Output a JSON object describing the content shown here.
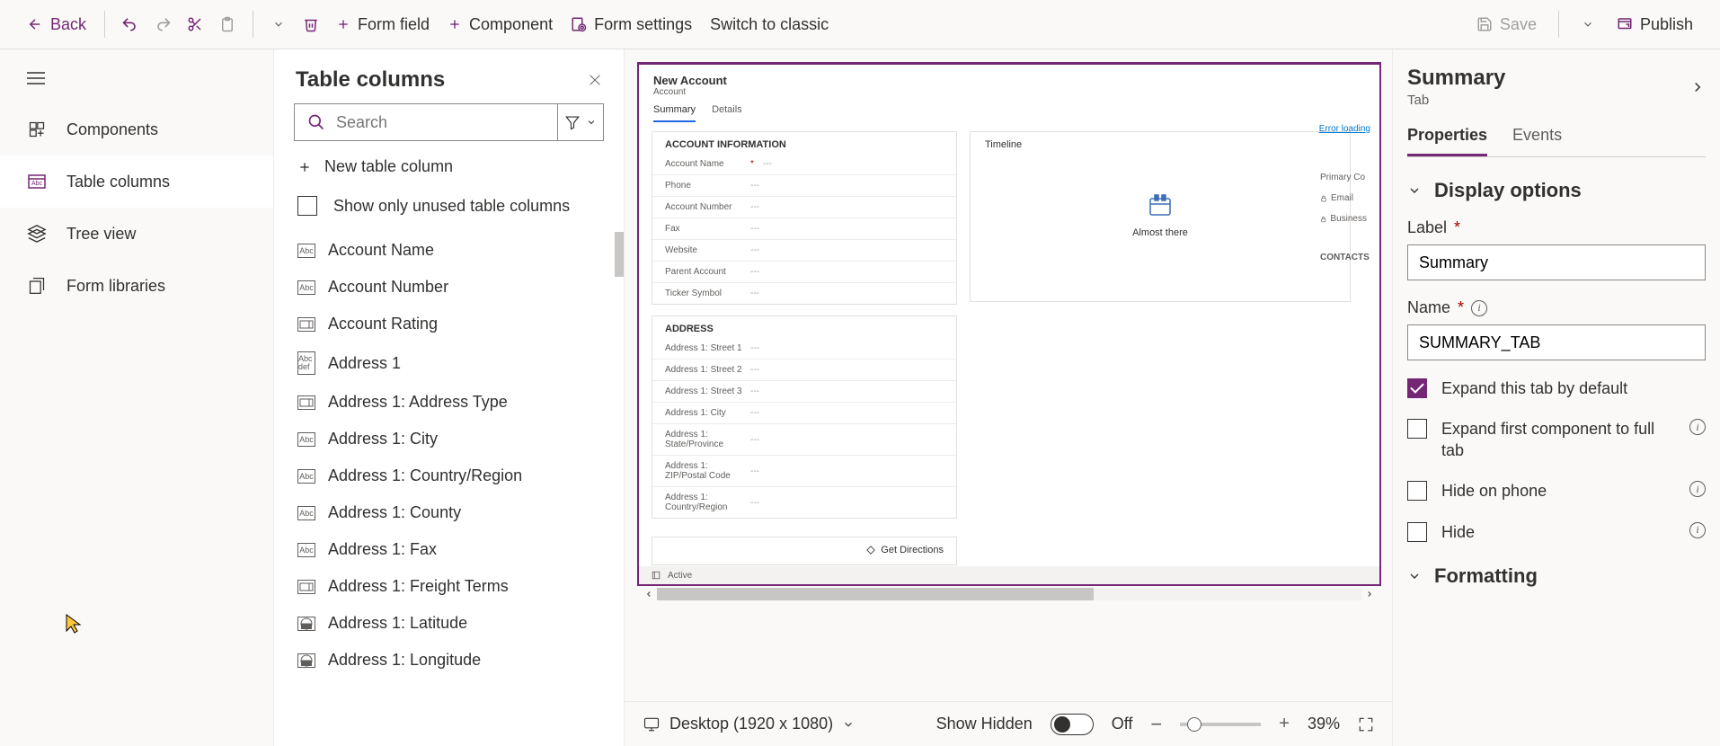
{
  "toolbar": {
    "back": "Back",
    "form_field": "Form field",
    "component": "Component",
    "form_settings": "Form settings",
    "switch_classic": "Switch to classic",
    "save": "Save",
    "publish": "Publish"
  },
  "left_rail": {
    "items": [
      {
        "label": "Components"
      },
      {
        "label": "Table columns"
      },
      {
        "label": "Tree view"
      },
      {
        "label": "Form libraries"
      }
    ]
  },
  "columns_panel": {
    "title": "Table columns",
    "search_placeholder": "Search",
    "new_col": "New table column",
    "show_unused": "Show only unused table columns",
    "columns": [
      {
        "icon": "Abc",
        "label": "Account Name"
      },
      {
        "icon": "Abc",
        "label": "Account Number"
      },
      {
        "icon": "opt",
        "label": "Account Rating"
      },
      {
        "icon": "Abc\ndef",
        "label": "Address 1"
      },
      {
        "icon": "opt",
        "label": "Address 1: Address Type"
      },
      {
        "icon": "Abc",
        "label": "Address 1: City"
      },
      {
        "icon": "Abc",
        "label": "Address 1: Country/Region"
      },
      {
        "icon": "Abc",
        "label": "Address 1: County"
      },
      {
        "icon": "Abc",
        "label": "Address 1: Fax"
      },
      {
        "icon": "opt",
        "label": "Address 1: Freight Terms"
      },
      {
        "icon": "geo",
        "label": "Address 1: Latitude"
      },
      {
        "icon": "geo",
        "label": "Address 1: Longitude"
      }
    ]
  },
  "form_preview": {
    "title": "New Account",
    "subtitle": "Account",
    "tabs": [
      "Summary",
      "Details"
    ],
    "error_loading": "Error loading",
    "section1_title": "ACCOUNT INFORMATION",
    "section1_fields": [
      {
        "label": "Account Name",
        "required": true,
        "value": "---"
      },
      {
        "label": "Phone",
        "value": "---"
      },
      {
        "label": "Account Number",
        "value": "---"
      },
      {
        "label": "Fax",
        "value": "---"
      },
      {
        "label": "Website",
        "value": "---"
      },
      {
        "label": "Parent Account",
        "value": "---"
      },
      {
        "label": "Ticker Symbol",
        "value": "---"
      }
    ],
    "section2_title": "ADDRESS",
    "section2_fields": [
      {
        "label": "Address 1: Street 1",
        "value": "---"
      },
      {
        "label": "Address 1: Street 2",
        "value": "---"
      },
      {
        "label": "Address 1: Street 3",
        "value": "---"
      },
      {
        "label": "Address 1: City",
        "value": "---"
      },
      {
        "label": "Address 1: State/Province",
        "value": "---"
      },
      {
        "label": "Address 1: ZIP/Postal Code",
        "value": "---"
      },
      {
        "label": "Address 1: Country/Region",
        "value": "---"
      }
    ],
    "get_directions": "Get Directions",
    "timeline_title": "Timeline",
    "timeline_status": "Almost there",
    "right_col": {
      "primary": "Primary Co",
      "email": "Email",
      "business": "Business",
      "contacts": "CONTACTS"
    },
    "status_bar": "Active"
  },
  "canvas_footer": {
    "device": "Desktop (1920 x 1080)",
    "show_hidden": "Show Hidden",
    "toggle_state": "Off",
    "zoom": "39%"
  },
  "props": {
    "title": "Summary",
    "subtitle": "Tab",
    "tabs": [
      "Properties",
      "Events"
    ],
    "section_display": "Display options",
    "label_label": "Label",
    "label_value": "Summary",
    "name_label": "Name",
    "name_value": "SUMMARY_TAB",
    "check_expand_default": "Expand this tab by default",
    "check_expand_first": "Expand first component to full tab",
    "check_hide_phone": "Hide on phone",
    "check_hide": "Hide",
    "section_formatting": "Formatting"
  }
}
